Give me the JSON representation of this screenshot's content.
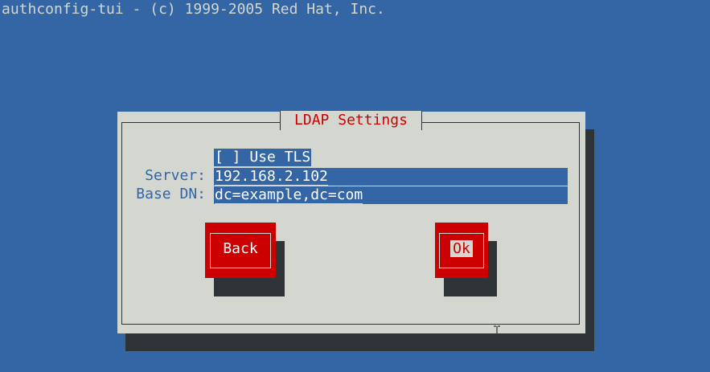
{
  "window": {
    "title": "authconfig-tui - (c) 1999-2005 Red Hat, Inc."
  },
  "dialog": {
    "title": "LDAP Settings",
    "use_tls": {
      "checkbox": "[ ]",
      "label": "Use TLS",
      "checked": false
    },
    "server": {
      "label": "Server:",
      "value": "192.168.2.102"
    },
    "base_dn": {
      "label": "Base DN:",
      "value": "dc=example,dc=com"
    },
    "buttons": {
      "back": "Back",
      "ok": "Ok"
    }
  },
  "colors": {
    "background": "#3465a4",
    "dialog": "#d3d7cf",
    "shadow": "#2e3436",
    "accent": "#cc0000"
  },
  "icons": {
    "cursor": "i-beam-cursor-icon"
  }
}
